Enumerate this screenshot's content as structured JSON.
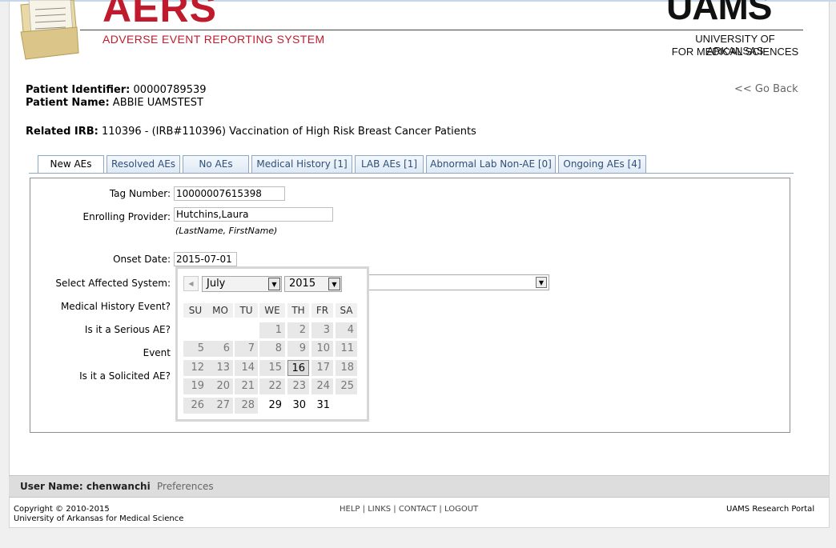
{
  "header": {
    "logo_title": "AERS",
    "logo_subtitle": "ADVERSE EVENT REPORTING SYSTEM",
    "org_logo": "UAMS",
    "org_line1": "UNIVERSITY OF ARKANSAS",
    "org_line2": "FOR MEDICAL SCIENCES"
  },
  "patient": {
    "id_label": "Patient Identifier:",
    "id_value": "00000789539",
    "name_label": "Patient Name:",
    "name_value": "ABBIE UAMSTEST",
    "irb_label": "Related IRB:",
    "irb_value": "110396  - (IRB#110396) Vaccination of High Risk Breast Cancer Patients"
  },
  "go_back": "<< Go Back",
  "tabs": [
    {
      "label": "New AEs",
      "active": true
    },
    {
      "label": "Resolved AEs"
    },
    {
      "label": "No AEs"
    },
    {
      "label": "Medical History [1]"
    },
    {
      "label": "LAB AEs [1]"
    },
    {
      "label": "Abnormal Lab Non-AE [0]"
    },
    {
      "label": "Ongoing AEs [4]"
    }
  ],
  "form": {
    "tag_label": "Tag Number:",
    "tag_value": "10000007615398",
    "provider_label": "Enrolling Provider:",
    "provider_value": "Hutchins,Laura",
    "provider_hint": "(LastName, FirstName)",
    "onset_label": "Onset Date:",
    "onset_value": "2015-07-01",
    "system_label": "Select Affected System:",
    "system_value": "",
    "medhist_label": "Medical History Event?",
    "serious_label": "Is it a Serious AE?",
    "event_label": "Event",
    "solicited_label": "Is it a Solicited AE?"
  },
  "calendar": {
    "month": "July",
    "year": "2015",
    "weekdays": [
      "SU",
      "MO",
      "TU",
      "WE",
      "TH",
      "FR",
      "SA"
    ],
    "today": 16,
    "weeks": [
      [
        "",
        "",
        "",
        "1",
        "2",
        "3",
        "4"
      ],
      [
        "5",
        "6",
        "7",
        "8",
        "9",
        "10",
        "11"
      ],
      [
        "12",
        "13",
        "14",
        "15",
        "16",
        "17",
        "18"
      ],
      [
        "19",
        "20",
        "21",
        "22",
        "23",
        "24",
        "25"
      ],
      [
        "26",
        "27",
        "28",
        "29",
        "30",
        "31",
        ""
      ]
    ]
  },
  "footer": {
    "user_label": "User Name: chenwanchi",
    "preferences": "Preferences",
    "copyright1": "Copyright © 2010-2015",
    "copyright2": "University of Arkansas for Medical Science",
    "links": [
      "HELP",
      "LINKS",
      "CONTACT",
      "LOGOUT"
    ],
    "portal": "UAMS Research Portal"
  },
  "colors": {
    "brand_red": "#bf1b2c",
    "tab_text": "#2e4f7a"
  }
}
